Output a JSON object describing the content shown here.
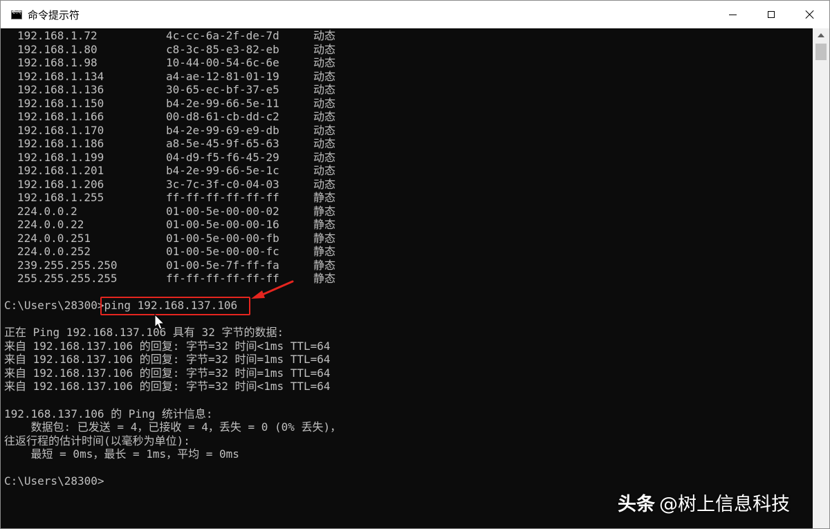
{
  "window": {
    "title": "命令提示符",
    "controls": {
      "minimize": "minimize-icon",
      "maximize": "maximize-icon",
      "close": "close-icon"
    }
  },
  "arp_table": [
    {
      "ip": "192.168.1.72",
      "mac": "4c-cc-6a-2f-de-7d",
      "type": "动态"
    },
    {
      "ip": "192.168.1.80",
      "mac": "c8-3c-85-e3-82-eb",
      "type": "动态"
    },
    {
      "ip": "192.168.1.98",
      "mac": "10-44-00-54-6c-6e",
      "type": "动态"
    },
    {
      "ip": "192.168.1.134",
      "mac": "a4-ae-12-81-01-19",
      "type": "动态"
    },
    {
      "ip": "192.168.1.136",
      "mac": "30-65-ec-bf-37-e5",
      "type": "动态"
    },
    {
      "ip": "192.168.1.150",
      "mac": "b4-2e-99-66-5e-11",
      "type": "动态"
    },
    {
      "ip": "192.168.1.166",
      "mac": "00-d8-61-cb-dd-c2",
      "type": "动态"
    },
    {
      "ip": "192.168.1.170",
      "mac": "b4-2e-99-69-e9-db",
      "type": "动态"
    },
    {
      "ip": "192.168.1.186",
      "mac": "a8-5e-45-9f-65-63",
      "type": "动态"
    },
    {
      "ip": "192.168.1.199",
      "mac": "04-d9-f5-f6-45-29",
      "type": "动态"
    },
    {
      "ip": "192.168.1.201",
      "mac": "b4-2e-99-66-5e-1c",
      "type": "动态"
    },
    {
      "ip": "192.168.1.206",
      "mac": "3c-7c-3f-c0-04-03",
      "type": "动态"
    },
    {
      "ip": "192.168.1.255",
      "mac": "ff-ff-ff-ff-ff-ff",
      "type": "静态"
    },
    {
      "ip": "224.0.0.2",
      "mac": "01-00-5e-00-00-02",
      "type": "静态"
    },
    {
      "ip": "224.0.0.22",
      "mac": "01-00-5e-00-00-16",
      "type": "静态"
    },
    {
      "ip": "224.0.0.251",
      "mac": "01-00-5e-00-00-fb",
      "type": "静态"
    },
    {
      "ip": "224.0.0.252",
      "mac": "01-00-5e-00-00-fc",
      "type": "静态"
    },
    {
      "ip": "239.255.255.250",
      "mac": "01-00-5e-7f-ff-fa",
      "type": "静态"
    },
    {
      "ip": "255.255.255.255",
      "mac": "ff-ff-ff-ff-ff-ff",
      "type": "静态"
    }
  ],
  "console": {
    "prompt1": "C:\\Users\\28300>",
    "command": "ping 192.168.137.106",
    "ping_header": "正在 Ping 192.168.137.106 具有 32 字节的数据:",
    "replies": [
      "来自 192.168.137.106 的回复: 字节=32 时间<1ms TTL=64",
      "来自 192.168.137.106 的回复: 字节=32 时间=1ms TTL=64",
      "来自 192.168.137.106 的回复: 字节=32 时间=1ms TTL=64",
      "来自 192.168.137.106 的回复: 字节=32 时间<1ms TTL=64"
    ],
    "stats_header": "192.168.137.106 的 Ping 统计信息:",
    "packets": "    数据包: 已发送 = 4，已接收 = 4，丢失 = 0 (0% 丢失)，",
    "rtt_header": "往返行程的估计时间(以毫秒为单位):",
    "rtt_values": "    最短 = 0ms，最长 = 1ms，平均 = 0ms",
    "prompt2": "C:\\Users\\28300>"
  },
  "watermark": {
    "brand": "头条",
    "handle": "@树上信息科技"
  },
  "colors": {
    "console_bg": "#0c0c0c",
    "console_text": "#c0c0c0",
    "highlight": "#e5251f"
  }
}
